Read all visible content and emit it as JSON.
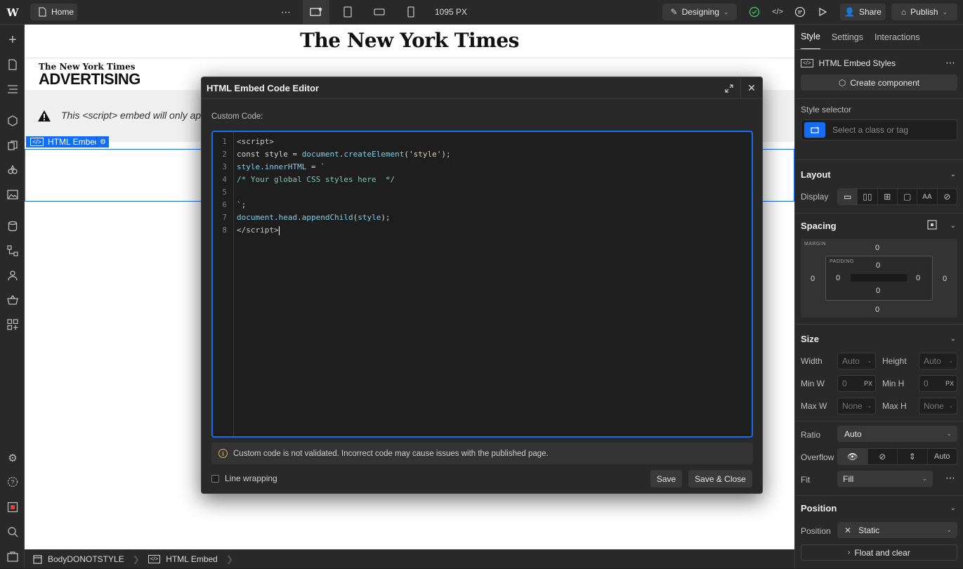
{
  "topbar": {
    "home_label": "Home",
    "viewport_width": "1095 PX",
    "mode_label": "Designing",
    "share_label": "Share",
    "publish_label": "Publish"
  },
  "canvas": {
    "masthead": "The New York Times",
    "adv_small": "The New York Times",
    "adv_big": "ADVERTISING",
    "warning_text": "This <script> embed will only ap",
    "embed_label": "HTML Embed"
  },
  "breadcrumbs": [
    {
      "label": "BodyDONOTSTYLE"
    },
    {
      "label": "HTML Embed"
    }
  ],
  "right_panel": {
    "tabs": [
      "Style",
      "Settings",
      "Interactions"
    ],
    "element_name": "HTML Embed Styles",
    "create_component": "Create component",
    "style_selector_label": "Style selector",
    "style_selector_placeholder": "Select a class or tag",
    "layout": {
      "title": "Layout",
      "display_label": "Display"
    },
    "spacing": {
      "title": "Spacing",
      "margin_label": "MARGIN",
      "padding_label": "PADDING",
      "margin": {
        "top": "0",
        "right": "0",
        "bottom": "0",
        "left": "0"
      },
      "padding": {
        "top": "0",
        "right": "0",
        "bottom": "0",
        "left": "0"
      }
    },
    "size": {
      "title": "Size",
      "width_label": "Width",
      "width_val": "Auto",
      "width_unit": "-",
      "height_label": "Height",
      "height_val": "Auto",
      "height_unit": "-",
      "minw_label": "Min W",
      "minw_val": "0",
      "minw_unit": "PX",
      "minh_label": "Min H",
      "minh_val": "0",
      "minh_unit": "PX",
      "maxw_label": "Max W",
      "maxw_val": "None",
      "maxw_unit": "-",
      "maxh_label": "Max H",
      "maxh_val": "None",
      "maxh_unit": "-",
      "ratio_label": "Ratio",
      "ratio_val": "Auto",
      "overflow_label": "Overflow",
      "overflow_auto": "Auto",
      "fit_label": "Fit",
      "fit_val": "Fill"
    },
    "position": {
      "title": "Position",
      "position_label": "Position",
      "position_val": "Static",
      "float_label": "Float and clear"
    }
  },
  "dialog": {
    "title": "HTML Embed Code Editor",
    "custom_code_label": "Custom Code:",
    "line_numbers": [
      "1",
      "2",
      "3",
      "4",
      "5",
      "6",
      "7",
      "8"
    ],
    "notice": "Custom code is not validated. Incorrect code may cause issues with the published page.",
    "line_wrapping": "Line wrapping",
    "save": "Save",
    "save_close": "Save & Close"
  },
  "colors": {
    "accent": "#146ef5",
    "bg_dark": "#1e1e1e",
    "panel": "#292929"
  }
}
